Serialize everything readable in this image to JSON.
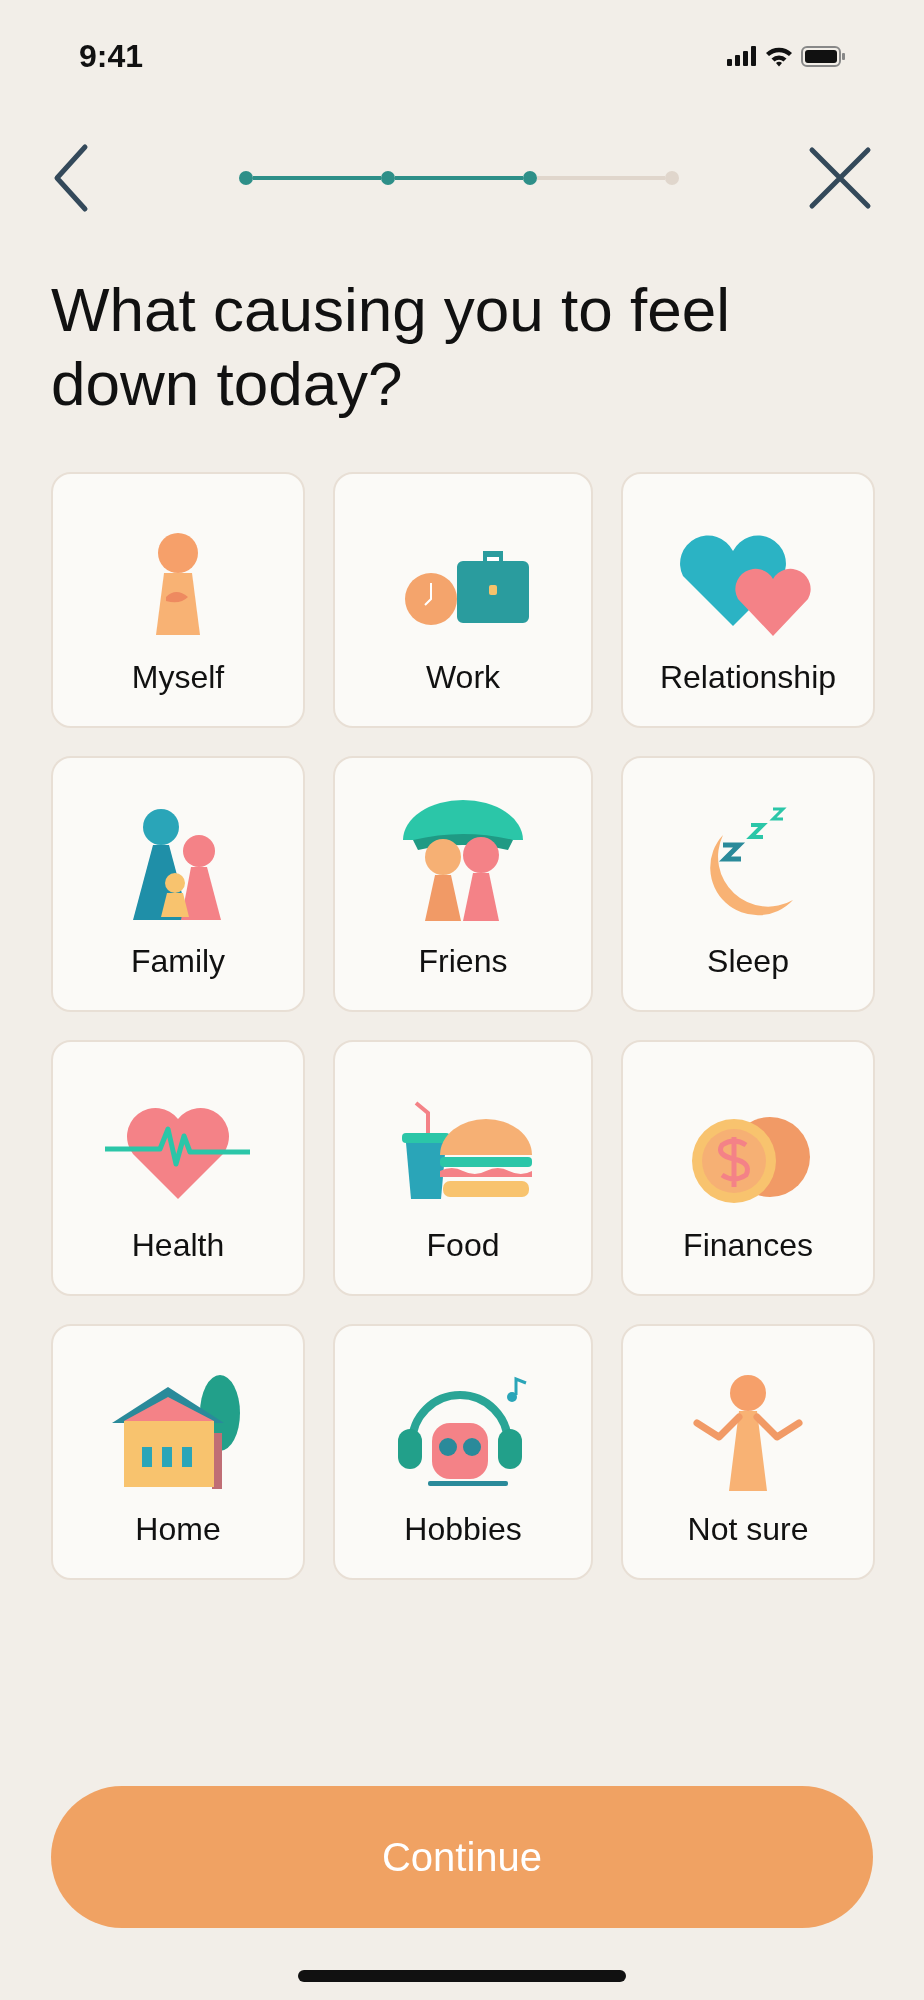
{
  "status_bar": {
    "time": "9:41"
  },
  "progress": {
    "steps": [
      {
        "done": true
      },
      {
        "done": true
      },
      {
        "done": true
      },
      {
        "done": false
      }
    ]
  },
  "title": "What causing you to feel down today?",
  "options": [
    {
      "label": "Myself",
      "selected": false
    },
    {
      "label": "Work",
      "selected": false
    },
    {
      "label": "Relationship",
      "selected": false
    },
    {
      "label": "Family",
      "selected": false
    },
    {
      "label": "Friens",
      "selected": false
    },
    {
      "label": "Sleep",
      "selected": false
    },
    {
      "label": "Health",
      "selected": false
    },
    {
      "label": "Food",
      "selected": false
    },
    {
      "label": "Finances",
      "selected": false
    },
    {
      "label": "Home",
      "selected": false
    },
    {
      "label": "Hobbies",
      "selected": false
    },
    {
      "label": "Not sure",
      "selected": false
    }
  ],
  "continue_button": "Continue"
}
